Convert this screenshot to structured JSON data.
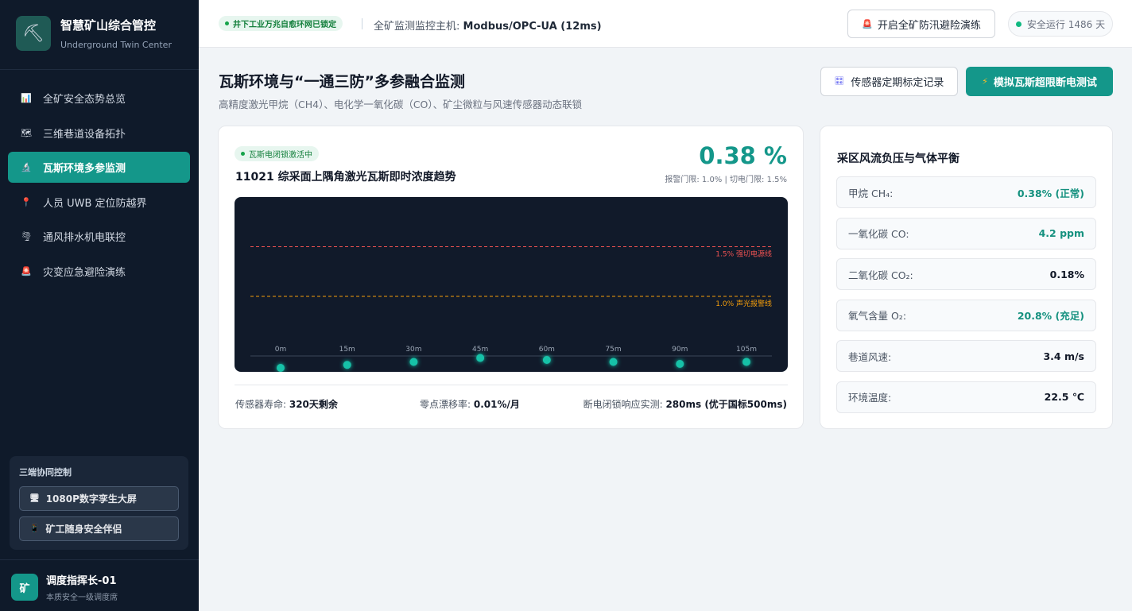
{
  "brand": {
    "logo": "⛏",
    "title": "智慧矿山综合管控",
    "subtitle": "Underground Twin Center"
  },
  "nav": [
    {
      "icon": "📊",
      "label": "全矿安全态势总览"
    },
    {
      "icon": "🗺",
      "label": "三维巷道设备拓扑"
    },
    {
      "icon": "🔬",
      "label": "瓦斯环境多参监测"
    },
    {
      "icon": "📍",
      "label": "人员 UWB 定位防越界"
    },
    {
      "icon": "🌪",
      "label": "通风排水机电联控"
    },
    {
      "icon": "🚨",
      "label": "灾变应急避险演练"
    }
  ],
  "collab": {
    "title": "三端协同控制",
    "buttons": [
      {
        "icon": "🖥",
        "label": "1080P数字孪生大屏"
      },
      {
        "icon": "📱",
        "label": "矿工随身安全伴侣"
      }
    ]
  },
  "user": {
    "avatar": "矿",
    "name": "调度指挥长-01",
    "role": "本质安全一级调度席"
  },
  "header": {
    "badge": "井下工业万兆自愈环网已锁定",
    "host_label": "全矿监测监控主机: ",
    "host_value": "Modbus/OPC-UA (12ms)",
    "drill_icon": "🚨",
    "drill_button": "开启全矿防汛避险演练",
    "safe_days": "安全运行 1486 天"
  },
  "page": {
    "title": "瓦斯环境与“一通三防”多参融合监测",
    "subtitle": "高精度激光甲烷（CH4）、电化学一氧化碳（CO）、矿尘微粒与风速传感器动态联锁",
    "calib_icon": "🎛",
    "calib_button": "传感器定期标定记录",
    "sim_icon": "⚡",
    "sim_button": "模拟瓦斯超限断电测试"
  },
  "monitor": {
    "lock_badge": "瓦斯电闭锁激活中",
    "title": "11021 综采面上隅角激光瓦斯即时浓度趋势",
    "value": "0.38 %",
    "threshold_note": "报警门限: 1.0% | 切电门限: 1.5%",
    "stats": [
      {
        "label": "传感器寿命: ",
        "value": "320天剩余"
      },
      {
        "label": "零点漂移率: ",
        "value": "0.01%/月"
      },
      {
        "label": "断电闭锁响应实测: ",
        "value": "280ms (优于国标500ms)"
      }
    ]
  },
  "chart_data": {
    "type": "scatter",
    "x": [
      "0m",
      "15m",
      "30m",
      "45m",
      "60m",
      "75m",
      "90m",
      "105m"
    ],
    "values": [
      0.28,
      0.31,
      0.34,
      0.38,
      0.36,
      0.34,
      0.32,
      0.34
    ],
    "ylim": [
      0,
      2.0
    ],
    "reference_lines": [
      {
        "label": "1.5% 强切电源线",
        "value": 1.5,
        "color": "#f05252"
      },
      {
        "label": "1.0% 声光报警线",
        "value": 1.0,
        "color": "#f59e0b"
      }
    ],
    "point_color": "#14c2a8",
    "grid": false
  },
  "balance": {
    "title": "采区风流负压与气体平衡",
    "rows": [
      {
        "label": "甲烷 CH₄:",
        "value": "0.38% (正常)",
        "status": "ok"
      },
      {
        "label": "一氧化碳 CO:",
        "value": "4.2 ppm",
        "status": "ok"
      },
      {
        "label": "二氧化碳 CO₂:",
        "value": "0.18%",
        "status": "normal"
      },
      {
        "label": "氧气含量 O₂:",
        "value": "20.8% (充足)",
        "status": "ok"
      },
      {
        "label": "巷道风速:",
        "value": "3.4 m/s",
        "status": "normal"
      },
      {
        "label": "环境温度:",
        "value": "22.5 ℃",
        "status": "normal"
      }
    ]
  }
}
